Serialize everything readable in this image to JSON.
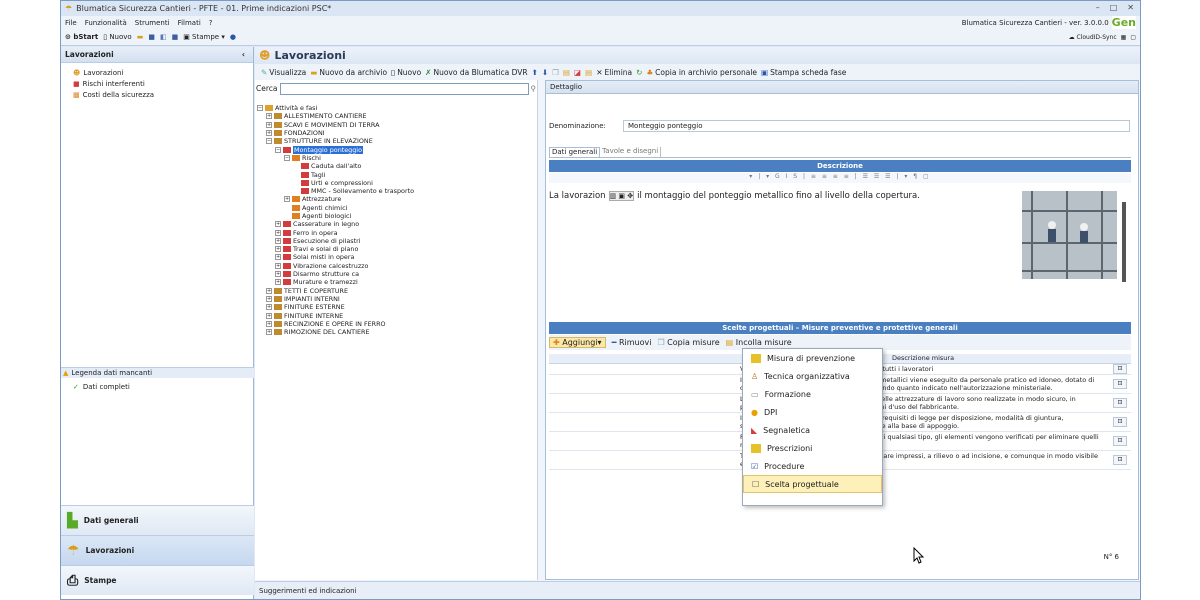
{
  "window": {
    "title": "Blumatica Sicurezza Cantieri - PFTE - 01. Prime indicazioni PSC*",
    "controls": [
      "–",
      "□",
      "✕"
    ]
  },
  "menu": {
    "items": [
      "File",
      "Funzionalità",
      "Strumenti",
      "Filmati",
      "?"
    ],
    "version": "Blumatica Sicurezza Cantieri - ver. 3.0.0.0",
    "gen": "Gen"
  },
  "toolbar": {
    "start": "bStart",
    "nuovo": "Nuovo",
    "stampe": "Stampe",
    "cloud": "CloudID-Sync"
  },
  "left": {
    "title": "Lavorazioni",
    "collapse": "‹",
    "items": [
      "Lavorazioni",
      "Rischi interferenti",
      "Costi della sicurezza"
    ],
    "legend": "Legenda dati mancanti",
    "dati_completi": "Dati completi",
    "nav": [
      "Dati generali",
      "Lavorazioni",
      "Stampe"
    ]
  },
  "main": {
    "title": "Lavorazioni",
    "toolbar": [
      "Visualizza",
      "Nuovo da archivio",
      "Nuovo",
      "Nuovo da Blumatica DVR",
      "Elimina",
      "Copia in archivio personale",
      "Stampa scheda fase"
    ],
    "search_label": "Cerca"
  },
  "tree": [
    {
      "l": "Attività e fasi",
      "d": 0,
      "pm": "−"
    },
    {
      "l": "ALLESTIMENTO CANTIERE",
      "d": 1,
      "pm": "+"
    },
    {
      "l": "SCAVI E MOVIMENTI DI TERRA",
      "d": 1,
      "pm": "+"
    },
    {
      "l": "FONDAZIONI",
      "d": 1,
      "pm": "+"
    },
    {
      "l": "STRUTTURE IN ELEVAZIONE",
      "d": 1,
      "pm": "−"
    },
    {
      "l": "Montaggio ponteggio",
      "d": 2,
      "pm": "−",
      "sel": true
    },
    {
      "l": "Rischi",
      "d": 3,
      "pm": "−"
    },
    {
      "l": "Caduta dall'alto",
      "d": 4,
      "pm": ""
    },
    {
      "l": "Tagli",
      "d": 4,
      "pm": ""
    },
    {
      "l": "Urti e compressioni",
      "d": 4,
      "pm": ""
    },
    {
      "l": "MMC - Sollevamento e trasporto",
      "d": 4,
      "pm": ""
    },
    {
      "l": "Attrezzature",
      "d": 3,
      "pm": "+"
    },
    {
      "l": "Agenti chimici",
      "d": 3,
      "pm": ""
    },
    {
      "l": "Agenti biologici",
      "d": 3,
      "pm": ""
    },
    {
      "l": "Casserature in legno",
      "d": 2,
      "pm": "+"
    },
    {
      "l": "Ferro in opera",
      "d": 2,
      "pm": "+"
    },
    {
      "l": "Esecuzione di pilastri",
      "d": 2,
      "pm": "+"
    },
    {
      "l": "Travi e solai di piano",
      "d": 2,
      "pm": "+"
    },
    {
      "l": "Solai misti in opera",
      "d": 2,
      "pm": "+"
    },
    {
      "l": "Vibrazione calcestruzzo",
      "d": 2,
      "pm": "+"
    },
    {
      "l": "Disarmo strutture ca",
      "d": 2,
      "pm": "+"
    },
    {
      "l": "Murature e tramezzi",
      "d": 2,
      "pm": "+"
    },
    {
      "l": "TETTI E COPERTURE",
      "d": 1,
      "pm": "+"
    },
    {
      "l": "IMPIANTI INTERNI",
      "d": 1,
      "pm": "+"
    },
    {
      "l": "FINITURE ESTERNE",
      "d": 1,
      "pm": "+"
    },
    {
      "l": "FINITURE INTERNE",
      "d": 1,
      "pm": "+"
    },
    {
      "l": "RECINZIONE E OPERE IN FERRO",
      "d": 1,
      "pm": "+"
    },
    {
      "l": "RIMOZIONE DEL CANTIERE",
      "d": 1,
      "pm": "+"
    }
  ],
  "detail": {
    "tab": "Dettaglio",
    "denom_label": "Denominazione:",
    "denom_value": "Monteggio ponteggio",
    "subtabs": [
      "Dati generali",
      "Tavole e disegni"
    ],
    "descr_header": "Descrizione",
    "text_start": "La lavorazion",
    "text_end": "il montaggio del ponteggio metallico fino al livello della copertura.",
    "scelte_header": "Scelte progettuali – Misure preventive e protettive generali",
    "scelte_toolbar": {
      "add": "Aggiungi",
      "remove": "Rimuovi",
      "copy": "Copia misure",
      "paste": "Incolla misure"
    },
    "col_header": "Descrizione misura",
    "rows": [
      "Verificare l'uso costante dei DPI da parte di tutti i lavoratori",
      "Il montaggio e lo smontaggio dei ponteggi metallici viene eseguito da personale pratico ed idoneo, dotato di dispositivi personali di protezione e rispettando quanto indicato nell'autorizzazione ministeriale.",
      "Le operazioni di montaggio e smontaggio delle attrezzature di lavoro sono realizzate in modo sicuro, in particolare rispettando le eventuali istruzioni d'uso del fabbricante.",
      "I montanti dei ponteggi devono rispettare i requisiti di legge per disposizione, modalità di giuntura, sovrapposizione, suddivisione, assicurazione alla base di appoggio.",
      "Prima di reimpiegare elementi di ponteggi di qualsiasi tipo, gli elementi vengono verificati per eliminare quelli non ritenuti più idonei.",
      "Tutti gli elementi dei ponteggi devono riportare impressi, a rilievo o ad incisione, e comunque in modo visibile ed indelebile il marchio del fabbricante."
    ],
    "count": "N° 6"
  },
  "dropdown": [
    "Misura di prevenzione",
    "Tecnica organizzativa",
    "Formazione",
    "DPI",
    "Segnaletica",
    "Prescrizioni",
    "Procedure",
    "Scelta progettuale"
  ],
  "footer": "Suggerimenti ed indicazioni"
}
